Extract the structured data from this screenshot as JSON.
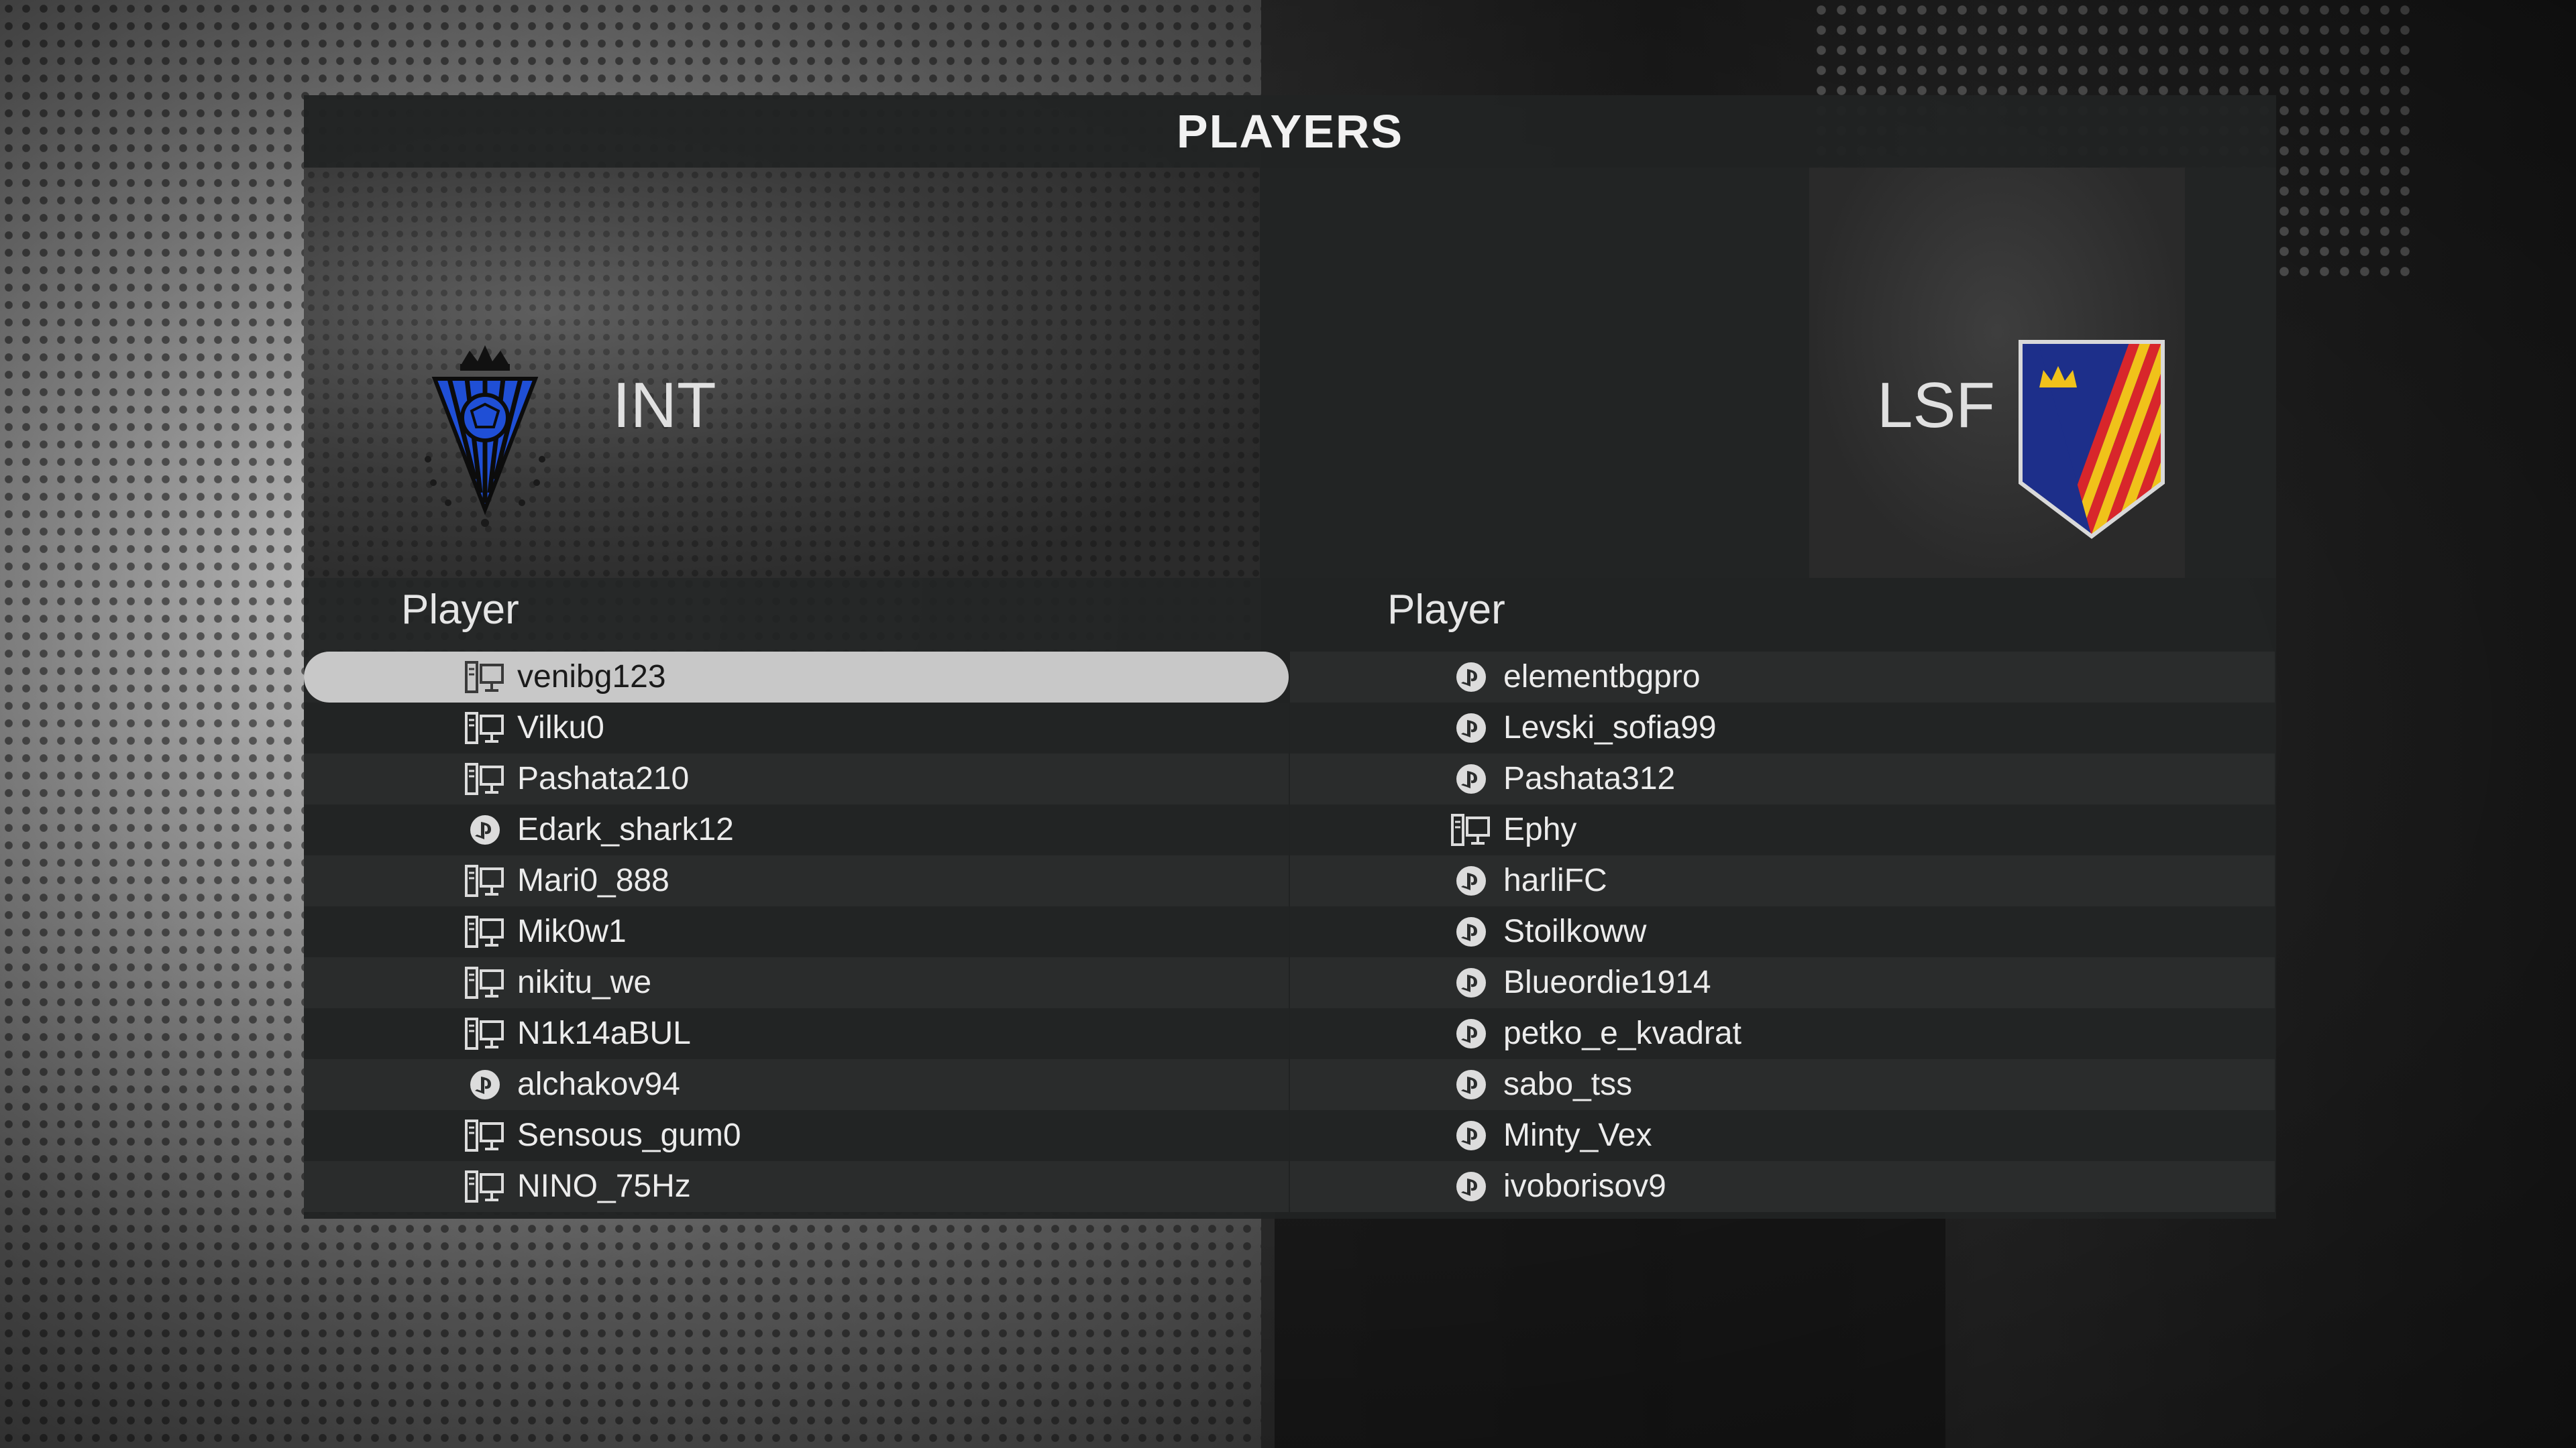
{
  "header": {
    "title": "PLAYERS"
  },
  "home_team": {
    "code": "INT",
    "column_header": "Player",
    "players": [
      {
        "name": "venibg123",
        "platform": "pc-icon",
        "selected": true
      },
      {
        "name": "Vilku0",
        "platform": "pc-icon"
      },
      {
        "name": "Pashata210",
        "platform": "pc-icon"
      },
      {
        "name": "Edark_shark12",
        "platform": "playstation-icon"
      },
      {
        "name": "Mari0_888",
        "platform": "pc-icon"
      },
      {
        "name": "Mik0w1",
        "platform": "pc-icon"
      },
      {
        "name": "nikitu_we",
        "platform": "pc-icon"
      },
      {
        "name": "N1k14aBUL",
        "platform": "pc-icon"
      },
      {
        "name": "alchakov94",
        "platform": "playstation-icon"
      },
      {
        "name": "Sensous_gum0",
        "platform": "pc-icon"
      },
      {
        "name": "NINO_75Hz",
        "platform": "pc-icon"
      }
    ],
    "crest_colors": {
      "primary": "#1f4fd6",
      "secondary": "#111111"
    }
  },
  "away_team": {
    "code": "LSF",
    "column_header": "Player",
    "players": [
      {
        "name": "elementbgpro",
        "platform": "playstation-icon"
      },
      {
        "name": "Levski_sofia99",
        "platform": "playstation-icon"
      },
      {
        "name": "Pashata312",
        "platform": "playstation-icon"
      },
      {
        "name": "Ephy",
        "platform": "pc-icon"
      },
      {
        "name": "harliFC",
        "platform": "playstation-icon"
      },
      {
        "name": "Stoilkoww",
        "platform": "playstation-icon"
      },
      {
        "name": "Blueordie1914",
        "platform": "playstation-icon"
      },
      {
        "name": "petko_e_kvadrat",
        "platform": "playstation-icon"
      },
      {
        "name": "sabo_tss",
        "platform": "playstation-icon"
      },
      {
        "name": "Minty_Vex",
        "platform": "playstation-icon"
      },
      {
        "name": "ivoborisov9",
        "platform": "playstation-icon"
      }
    ],
    "crest_colors": {
      "primary": "#1d2f8a",
      "stripe_a": "#d8262b",
      "stripe_b": "#f0c21a",
      "crown": "#f0c21a"
    }
  },
  "colors": {
    "panel": "#212323",
    "row_selected": "#c8c8c8",
    "text": "#ececec"
  }
}
